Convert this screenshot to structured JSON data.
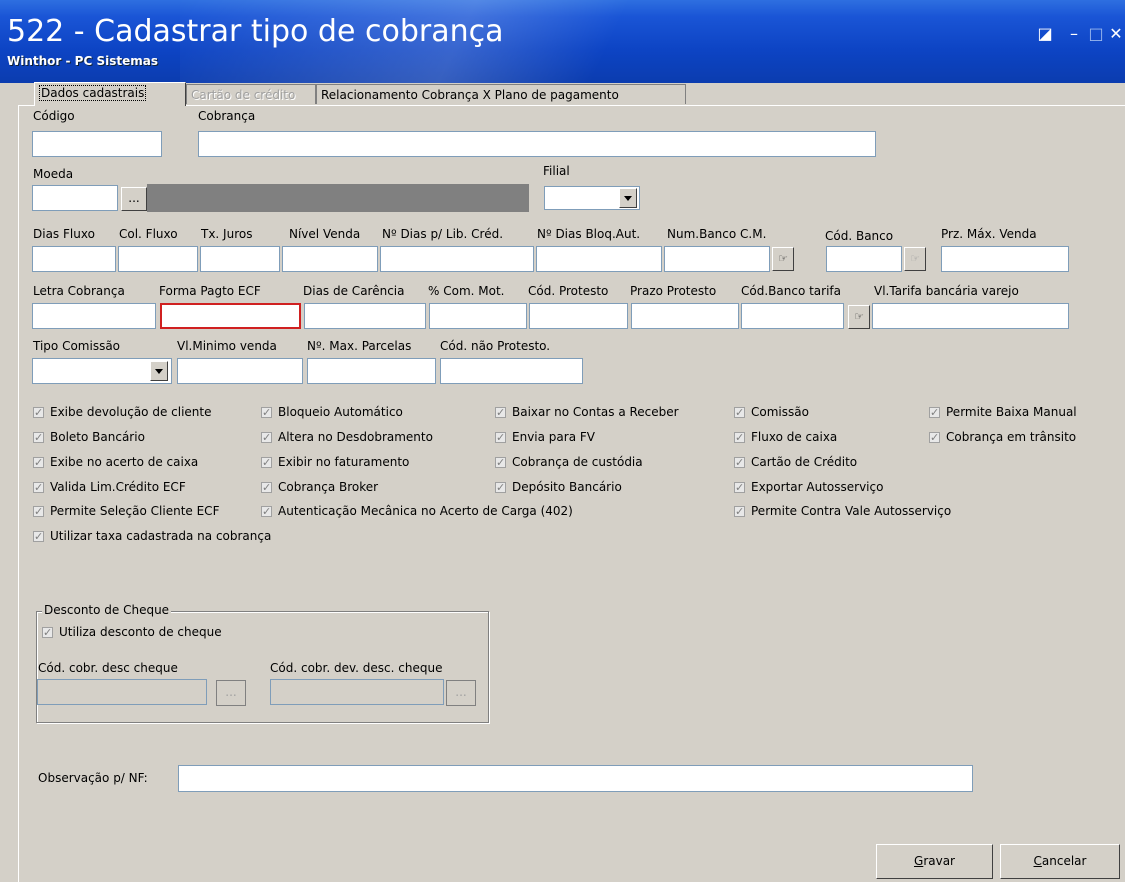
{
  "window": {
    "title": "522 - Cadastrar tipo de cobrança",
    "subtitle": "Winthor - PC Sistemas"
  },
  "tabs": [
    {
      "label": "Dados cadastrais",
      "active": true
    },
    {
      "label": "Cartão de crédito",
      "disabled": true
    },
    {
      "label": "Relacionamento Cobrança X Plano de pagamento"
    }
  ],
  "row1": {
    "codigo": "Código",
    "cobranca": "Cobrança"
  },
  "row2": {
    "moeda": "Moeda",
    "filial": "Filial",
    "ellipsis": "..."
  },
  "row3": {
    "labels": [
      "Dias Fluxo",
      "Col. Fluxo",
      "Tx. Juros",
      "Nível Venda",
      "Nº Dias p/ Lib. Créd.",
      "Nº Dias Bloq.Aut.",
      "Num.Banco C.M.",
      "Cód. Banco",
      "Prz. Máx. Venda"
    ]
  },
  "row4": {
    "labels": [
      "Letra Cobrança",
      "Forma Pagto ECF",
      "Dias de Carência",
      "% Com. Mot.",
      "Cód. Protesto",
      "Prazo Protesto",
      "Cód.Banco tarifa",
      "Vl.Tarifa bancária varejo"
    ]
  },
  "row5": {
    "labels": [
      "Tipo Comissão",
      "Vl.Minimo venda",
      "Nº. Max. Parcelas",
      "Cód. não  Protesto."
    ]
  },
  "checkboxes": {
    "col1": [
      "Exibe devolução de cliente",
      "Boleto Bancário",
      "Exibe no acerto de caixa",
      "Valida Lim.Crédito ECF",
      "Permite Seleção Cliente ECF",
      "Utilizar taxa cadastrada na cobrança"
    ],
    "col2": [
      "Bloqueio Automático",
      "Altera no Desdobramento",
      "Exibir no faturamento",
      "Cobrança Broker",
      "Autenticação Mecânica no Acerto de Carga (402)"
    ],
    "col3": [
      "Baixar no Contas a Receber",
      "Envia para FV",
      "Cobrança de custódia",
      "Depósito Bancário"
    ],
    "col4": [
      "Comissão",
      "Fluxo de caixa",
      "Cartão de Crédito",
      "Exportar Autosserviço",
      "Permite Contra Vale Autosserviço"
    ],
    "col5": [
      "Permite Baixa Manual",
      "Cobrança em trânsito"
    ]
  },
  "desconto": {
    "title": "Desconto de Cheque",
    "utiliza": "Utiliza desconto de cheque",
    "cod_desc": "Cód. cobr. desc cheque",
    "cod_dev": "Cód. cobr. dev. desc. cheque"
  },
  "observacao": {
    "label": "Observação p/ NF:"
  },
  "buttons": {
    "gravar_first": "G",
    "gravar_rest": "ravar",
    "cancelar_first": "C",
    "cancelar_rest": "ancelar"
  }
}
